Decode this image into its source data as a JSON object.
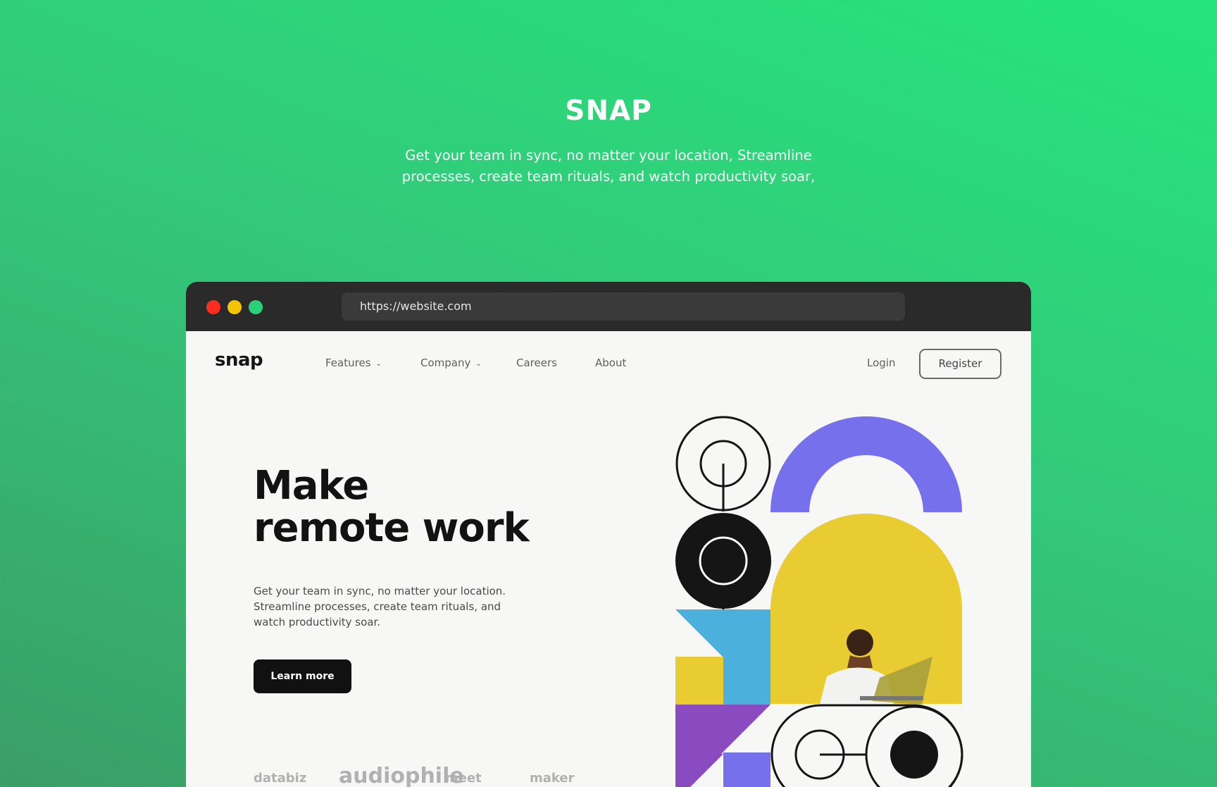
{
  "hero": {
    "title": "SNAP",
    "subtitle": "Get your team in sync, no matter your location, Streamline processes, create team rituals, and watch productivity soar,"
  },
  "browser": {
    "url": "https://website.com",
    "traffic_lights": {
      "close_color": "#ff2d20",
      "minimize_color": "#f5c400",
      "maximize_color": "#2bd07a"
    }
  },
  "site": {
    "logo": "snap",
    "nav": {
      "features": "Features",
      "company": "Company",
      "careers": "Careers",
      "about": "About"
    },
    "login": "Login",
    "register": "Register",
    "headline_line1": "Make",
    "headline_line2": "remote work",
    "description": "Get your team in sync, no matter your location. Streamline processes, create team rituals, and watch productivity soar.",
    "cta": "Learn more",
    "client_logos": {
      "databiz": "databiz",
      "audiophile": "audiophile",
      "meet": "meet",
      "maker": "maker"
    },
    "art_colors": {
      "purple": "#7670ec",
      "yellow": "#e9cb32",
      "blue": "#4cb0dd",
      "violet": "#8b4bc0",
      "black": "#151515"
    }
  }
}
